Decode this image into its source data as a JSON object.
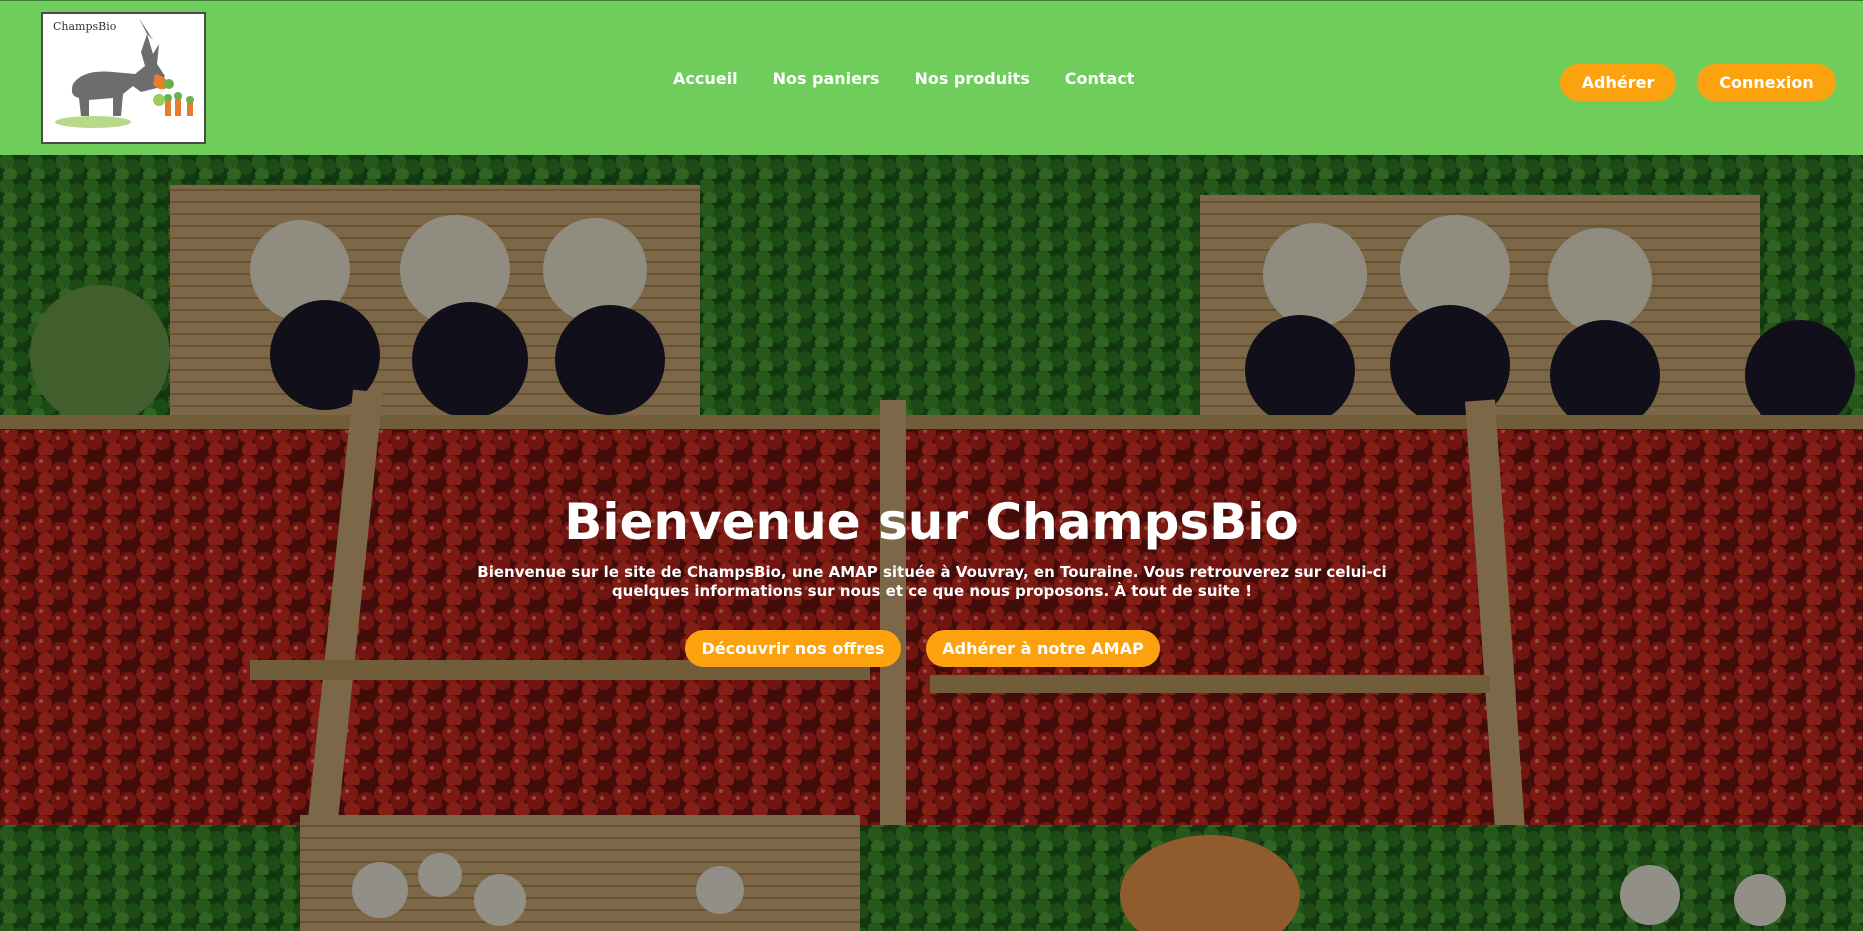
{
  "brand": {
    "name": "ChampsBio",
    "accent": "#6fcd5b",
    "button_color": "#fca20f"
  },
  "nav": {
    "items": [
      {
        "label": "Accueil"
      },
      {
        "label": "Nos paniers"
      },
      {
        "label": "Nos produits"
      },
      {
        "label": "Contact"
      }
    ]
  },
  "header_actions": {
    "join_label": "Adhérer",
    "login_label": "Connexion"
  },
  "hero": {
    "title": "Bienvenue sur ChampsBio",
    "text": "Bienvenue sur le site de ChampsBio, une AMAP située à Vouvray, en Touraine. Vous retrouverez sur celui-ci quelques informations sur nous et ce que nous proposons. À tout de suite !",
    "primary_cta": "Découvrir nos offres",
    "secondary_cta": "Adhérer à notre AMAP"
  }
}
